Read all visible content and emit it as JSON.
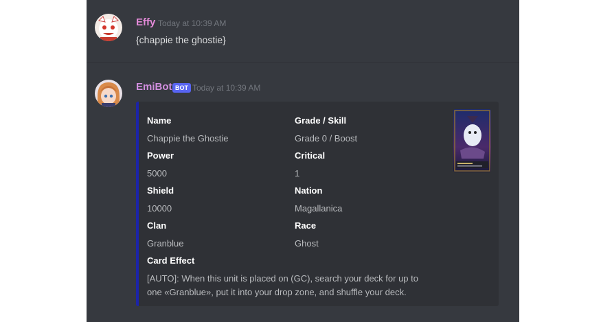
{
  "messages": [
    {
      "username": "Effy",
      "timestamp": "Today at 10:39 AM",
      "content": "{chappie the ghostie}"
    },
    {
      "username": "EmiBot",
      "badge": "BOT",
      "timestamp": "Today at 10:39 AM",
      "embed": {
        "fields": {
          "name": {
            "label": "Name",
            "value": "Chappie the Ghostie"
          },
          "grade": {
            "label": "Grade / Skill",
            "value": "Grade 0 / Boost"
          },
          "power": {
            "label": "Power",
            "value": "5000"
          },
          "critical": {
            "label": "Critical",
            "value": "1"
          },
          "shield": {
            "label": "Shield",
            "value": "10000"
          },
          "nation": {
            "label": "Nation",
            "value": "Magallanica"
          },
          "clan": {
            "label": "Clan",
            "value": "Granblue"
          },
          "race": {
            "label": "Race",
            "value": "Ghost"
          },
          "effect": {
            "label": "Card Effect",
            "value": "[AUTO]: When this unit is placed on (GC), search your deck for up to one «Granblue», put it into your drop zone, and shuffle your deck."
          }
        }
      }
    }
  ],
  "colors": {
    "background": "#36393f",
    "embed_background": "#2f3136",
    "embed_accent": "#1c24a8",
    "username_effy": "#e38ad8",
    "username_emibot": "#d28fe0",
    "badge": "#5865f2"
  }
}
